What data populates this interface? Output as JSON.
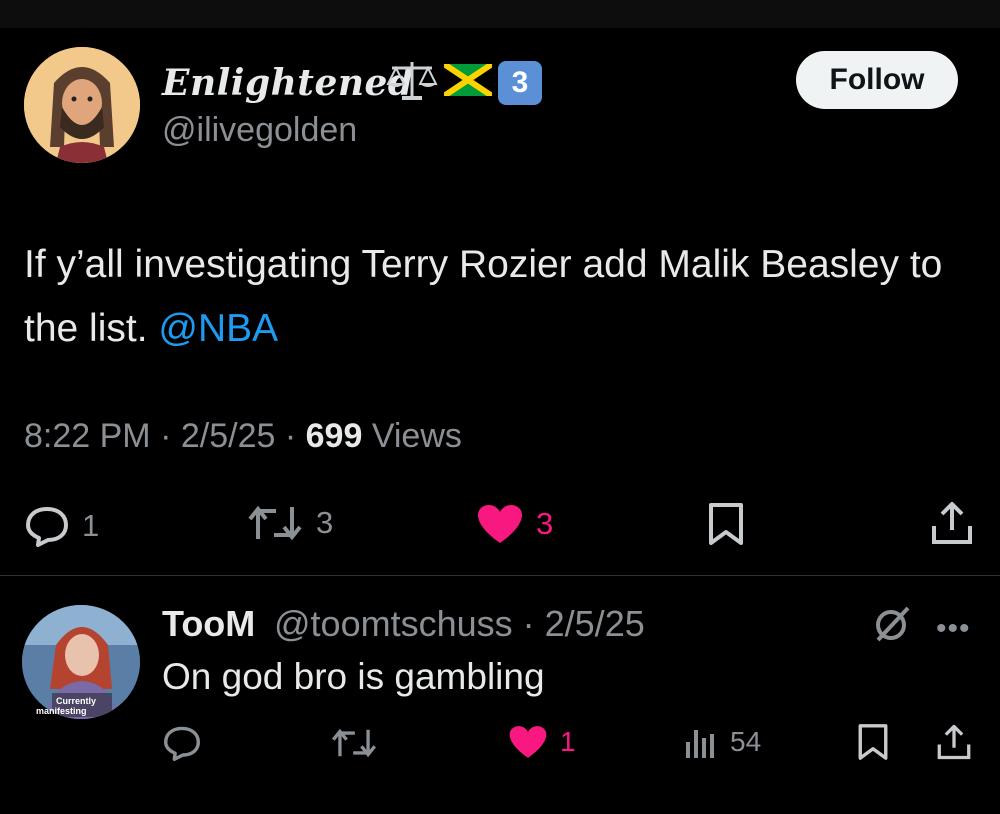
{
  "tweet": {
    "display_name": "Enlightened",
    "badges": [
      "balance-scale-icon",
      "jamaica-flag-icon",
      "keycap-3-icon"
    ],
    "keycap_label": "3",
    "handle": "@ilivegolden",
    "follow_label": "Follow",
    "text_part1": "If y’all investigating Terry Rozier add Malik Beasley to the list.",
    "mention": "@NBA",
    "time": "8:22 PM",
    "date": "2/5/25",
    "views_count": "699",
    "views_label": "Views",
    "stats": {
      "replies": "1",
      "reposts": "3",
      "likes": "3"
    },
    "like_color": "#f91880"
  },
  "reply": {
    "name": "TooM",
    "handle": "@toomtschuss",
    "date": "2/5/25",
    "text": "On god bro is gambling",
    "avatar_caption_line1": "Currently",
    "avatar_caption_line2": "manifesting",
    "stats": {
      "likes": "1",
      "views": "54"
    }
  }
}
